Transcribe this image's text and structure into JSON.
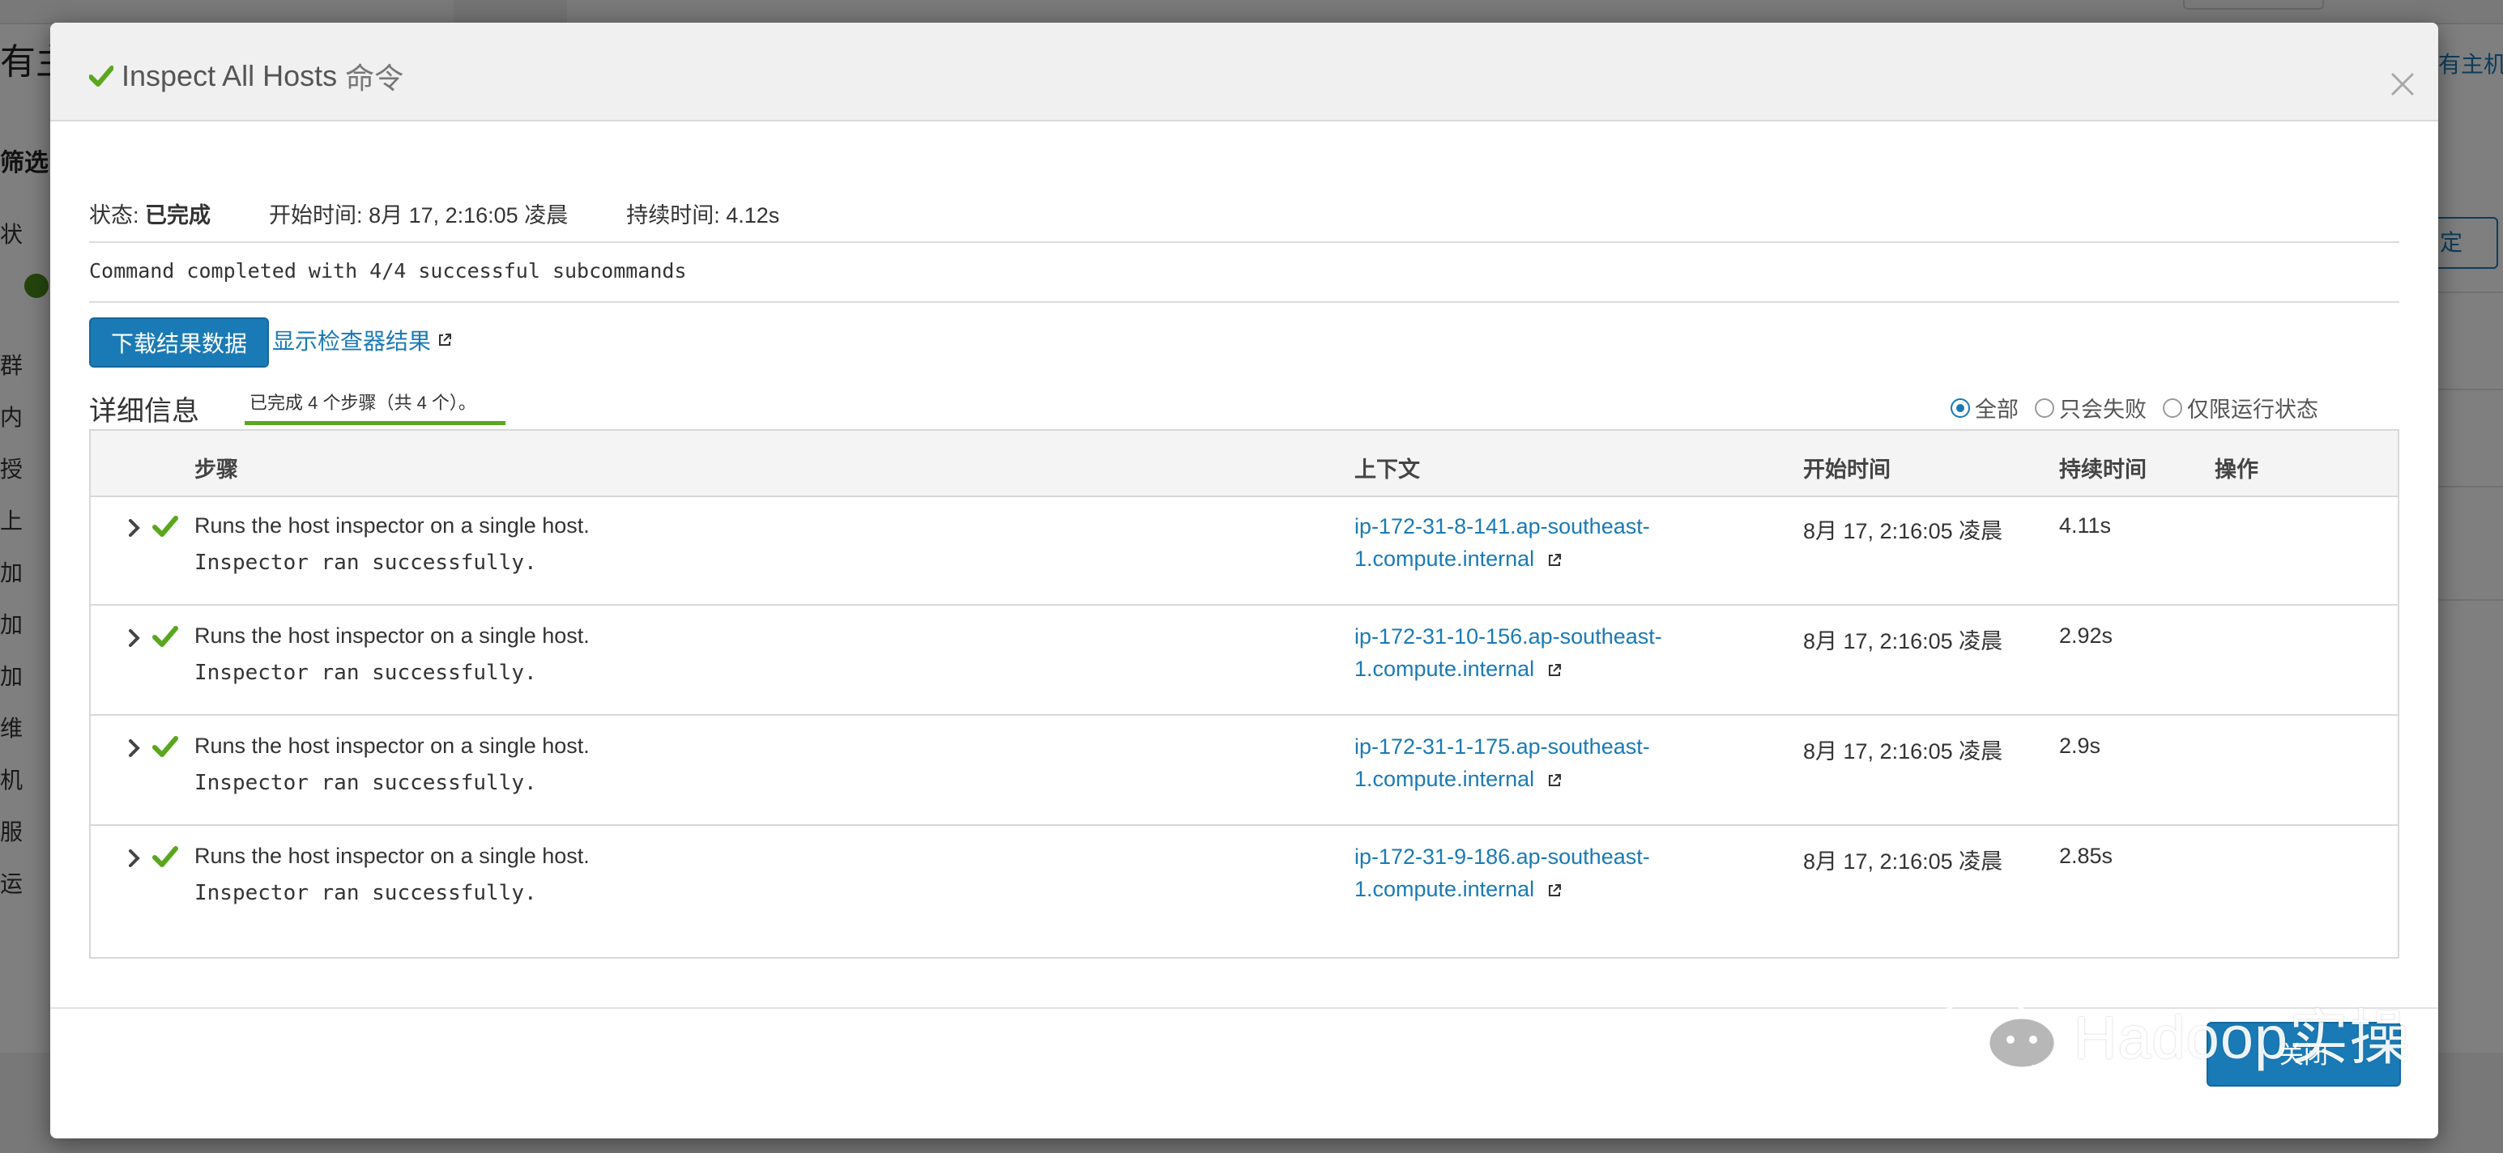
{
  "background": {
    "title_fragment": "有主",
    "filter_fragment": "筛选",
    "left_items": [
      "状",
      "群",
      "内",
      "授",
      "上",
      "加",
      "加",
      "加",
      "维",
      "机",
      "服",
      "运"
    ],
    "right_link_fragment": "有主机",
    "right_button_fragment": "定"
  },
  "modal": {
    "title_main": "Inspect All Hosts",
    "title_suffix": "命令",
    "status_label": "状态:",
    "status_value": "已完成",
    "start_label": "开始时间:",
    "start_value": "8月 17, 2:16:05 凌晨",
    "duration_label": "持续时间:",
    "duration_value": "4.12s",
    "command_message": "Command completed with 4/4 successful subcommands",
    "download_button": "下载结果数据",
    "inspector_link": "显示检查器结果",
    "details_title": "详细信息",
    "progress_text": "已完成 4 个步骤（共 4 个）。",
    "filters": [
      {
        "label": "全部",
        "selected": true
      },
      {
        "label": "只会失败",
        "selected": false
      },
      {
        "label": "仅限运行状态",
        "selected": false
      }
    ],
    "table": {
      "headers": {
        "step": "步骤",
        "context": "上下文",
        "start_time": "开始时间",
        "duration": "持续时间",
        "actions": "操作"
      },
      "rows": [
        {
          "step_title": "Runs the host inspector on a single host.",
          "step_message": "Inspector ran successfully.",
          "host_line1": "ip-172-31-8-141.ap-southeast-",
          "host_line2": "1.compute.internal",
          "start_time": "8月 17, 2:16:05 凌晨",
          "duration": "4.11s"
        },
        {
          "step_title": "Runs the host inspector on a single host.",
          "step_message": "Inspector ran successfully.",
          "host_line1": "ip-172-31-10-156.ap-southeast-",
          "host_line2": "1.compute.internal",
          "start_time": "8月 17, 2:16:05 凌晨",
          "duration": "2.92s"
        },
        {
          "step_title": "Runs the host inspector on a single host.",
          "step_message": "Inspector ran successfully.",
          "host_line1": "ip-172-31-1-175.ap-southeast-",
          "host_line2": "1.compute.internal",
          "start_time": "8月 17, 2:16:05 凌晨",
          "duration": "2.9s"
        },
        {
          "step_title": "Runs the host inspector on a single host.",
          "step_message": "Inspector ran successfully.",
          "host_line1": "ip-172-31-9-186.ap-southeast-",
          "host_line2": "1.compute.internal",
          "start_time": "8月 17, 2:16:05 凌晨",
          "duration": "2.85s"
        }
      ]
    },
    "close_button": "关闭"
  },
  "watermark": {
    "text": "Hadoop实操"
  },
  "colors": {
    "accent": "#1a7ab5",
    "success": "#5aa71e",
    "header_bg": "#f0f0f0"
  },
  "icons": {
    "title_check": "check-icon",
    "close": "close-icon",
    "external": "external-link-icon",
    "expand": "chevron-right-icon",
    "watermark_logo": "wechat-logo"
  }
}
